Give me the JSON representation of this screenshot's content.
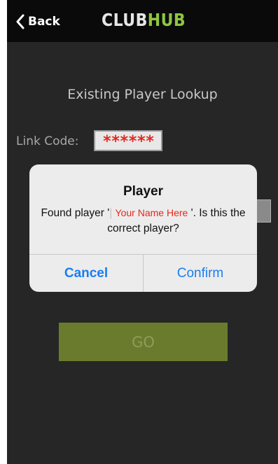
{
  "navbar": {
    "back_label": "Back",
    "logo_club": "CLUB",
    "logo_hub": "HUB"
  },
  "page": {
    "heading": "Existing Player Lookup",
    "link_code_label": "Link Code:",
    "link_code_value": "******",
    "go_label": "GO"
  },
  "alert": {
    "title": "Player",
    "message_prefix": "Found player '",
    "player_name": "Your Name Here",
    "message_suffix": "'. Is this the correct player?",
    "cancel_label": "Cancel",
    "confirm_label": "Confirm"
  },
  "colors": {
    "accent_green": "#8ec63f",
    "go_button": "#6b7b2d",
    "ios_blue": "#1a7df2",
    "name_red": "#e8261c"
  }
}
